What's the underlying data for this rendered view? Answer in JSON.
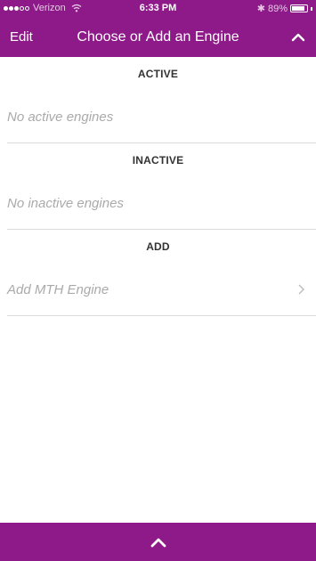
{
  "status_bar": {
    "carrier": "Verizon",
    "time": "6:33 PM",
    "battery_percent": "89%",
    "battery_level": 0.89,
    "icons": [
      "signal-dots",
      "wifi-icon",
      "bluetooth-icon",
      "battery-icon"
    ]
  },
  "nav": {
    "edit_label": "Edit",
    "title": "Choose or Add an Engine",
    "collapse_icon": "chevron-up-icon"
  },
  "sections": {
    "active": {
      "header": "ACTIVE",
      "empty_text": "No active engines"
    },
    "inactive": {
      "header": "INACTIVE",
      "empty_text": "No inactive engines"
    },
    "add": {
      "header": "ADD",
      "item_label": "Add MTH Engine",
      "item_icon": "chevron-right-icon"
    }
  },
  "bottom_bar": {
    "icon": "chevron-up-icon"
  },
  "colors": {
    "brand": "#8d1a88",
    "placeholder_text": "#aaaaaa",
    "separator": "#dadada"
  }
}
